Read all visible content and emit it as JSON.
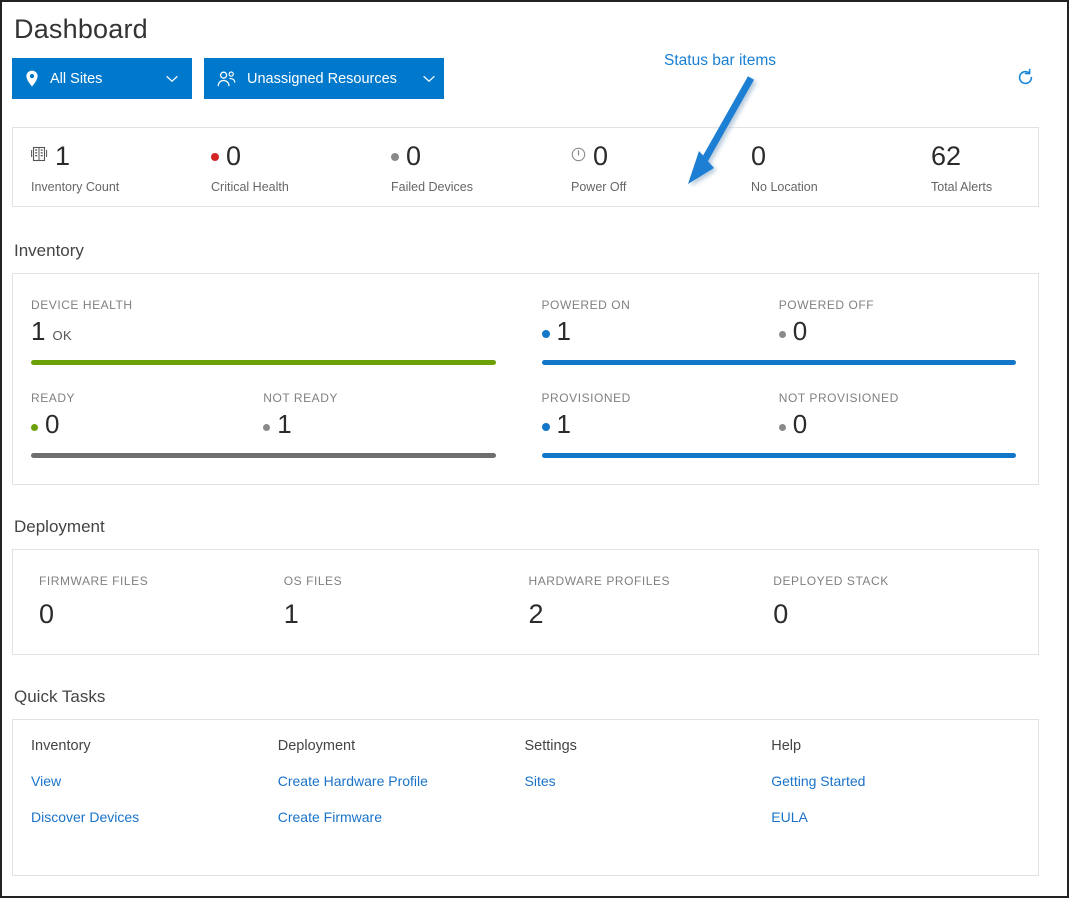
{
  "header": {
    "title": "Dashboard",
    "site_filter": {
      "label": "All Sites",
      "icon": "map-pin-icon",
      "chevron": "chevron-down-icon"
    },
    "resource_filter": {
      "label": "Unassigned Resources",
      "icon": "users-icon",
      "chevron": "chevron-down-icon"
    },
    "refresh": {
      "icon": "refresh-icon"
    }
  },
  "annotation": {
    "text": "Status bar items",
    "color": "#1a7fd4"
  },
  "status_bar": [
    {
      "value": "1",
      "label": "Inventory Count",
      "icon": "server-rack-icon",
      "marker": "icon"
    },
    {
      "value": "0",
      "label": "Critical Health",
      "icon": "red-dot-icon",
      "marker": "dot-red"
    },
    {
      "value": "0",
      "label": "Failed Devices",
      "icon": "grey-dot-icon",
      "marker": "dot-grey"
    },
    {
      "value": "0",
      "label": "Power Off",
      "icon": "power-icon",
      "marker": "power"
    },
    {
      "value": "0",
      "label": "No Location",
      "icon": "none",
      "marker": "none"
    },
    {
      "value": "62",
      "label": "Total Alerts",
      "icon": "none",
      "marker": "none"
    }
  ],
  "inventory": {
    "section_title": "Inventory",
    "rows": [
      {
        "left": {
          "bar_color": "#6ba006",
          "cells": [
            {
              "label": "DEVICE HEALTH",
              "value": "1",
              "suffix": "OK",
              "marker": "none"
            }
          ]
        },
        "right": {
          "bar_color": "#1277c8",
          "cells": [
            {
              "label": "POWERED ON",
              "value": "1",
              "suffix": "",
              "marker": "dot-blue"
            },
            {
              "label": "POWERED OFF",
              "value": "0",
              "suffix": "",
              "marker": "dot-grey"
            }
          ]
        }
      },
      {
        "left": {
          "bar_color": "#6e6e6e",
          "cells": [
            {
              "label": "READY",
              "value": "0",
              "suffix": "",
              "marker": "dot-green"
            },
            {
              "label": "NOT READY",
              "value": "1",
              "suffix": "",
              "marker": "dot-grey"
            }
          ]
        },
        "right": {
          "bar_color": "#1277c8",
          "cells": [
            {
              "label": "PROVISIONED",
              "value": "1",
              "suffix": "",
              "marker": "dot-blue"
            },
            {
              "label": "NOT PROVISIONED",
              "value": "0",
              "suffix": "",
              "marker": "dot-grey"
            }
          ]
        }
      }
    ]
  },
  "deployment": {
    "section_title": "Deployment",
    "cells": [
      {
        "label": "FIRMWARE FILES",
        "value": "0"
      },
      {
        "label": "OS FILES",
        "value": "1"
      },
      {
        "label": "HARDWARE PROFILES",
        "value": "2"
      },
      {
        "label": "DEPLOYED STACK",
        "value": "0"
      }
    ]
  },
  "quick_tasks": {
    "section_title": "Quick Tasks",
    "columns": [
      {
        "heading": "Inventory",
        "links": [
          "View",
          "Discover Devices"
        ]
      },
      {
        "heading": "Deployment",
        "links": [
          "Create Hardware Profile",
          "Create Firmware"
        ]
      },
      {
        "heading": "Settings",
        "links": [
          "Sites"
        ]
      },
      {
        "heading": "Help",
        "links": [
          "Getting Started",
          "EULA"
        ]
      }
    ]
  }
}
